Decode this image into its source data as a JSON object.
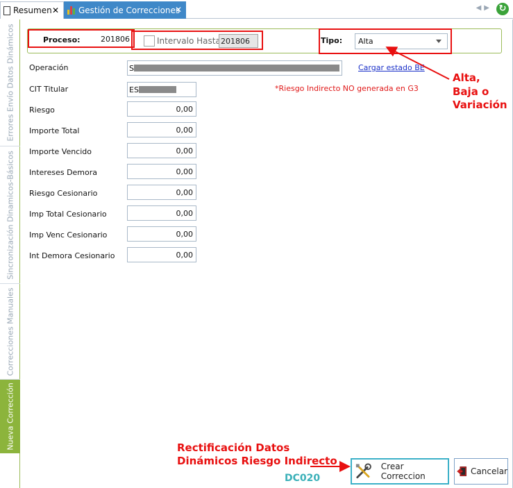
{
  "tabs": [
    {
      "label": "Resumen",
      "active": false
    },
    {
      "label": "Gestión de Correcciones",
      "active": true
    }
  ],
  "side_tabs": [
    {
      "label": "Errores Envío Datos Dinámicos"
    },
    {
      "label": "Sincronización Dinamicos-Básicos"
    },
    {
      "label": "Correcciones Manuales"
    },
    {
      "label": "Nueva Corrección",
      "active": true
    }
  ],
  "header": {
    "proceso_label": "Proceso:",
    "proceso_value": "201806",
    "intervalo_label": "Intervalo Hasta",
    "intervalo_checked": false,
    "intervalo_value": "201806",
    "tipo_label": "Tipo:",
    "tipo_value": "Alta"
  },
  "form": {
    "operacion_label": "Operación",
    "operacion_value": "S",
    "cargar_link": "Cargar estado BE",
    "cit_label": "CIT Titular",
    "cit_value": "ES",
    "warning": "*Riesgo Indirecto NO generada en G3",
    "fields": [
      {
        "label": "Riesgo",
        "value": "0,00"
      },
      {
        "label": "Importe Total",
        "value": "0,00"
      },
      {
        "label": "Importe Vencido",
        "value": "0,00"
      },
      {
        "label": "Intereses Demora",
        "value": "0,00"
      },
      {
        "label": "Riesgo Cesionario",
        "value": "0,00"
      },
      {
        "label": "Imp Total Cesionario",
        "value": "0,00"
      },
      {
        "label": "Imp Venc Cesionario",
        "value": "0,00"
      },
      {
        "label": "Int Demora Cesionario",
        "value": "0,00"
      }
    ]
  },
  "annotations": {
    "tipo_note_1": "Alta,",
    "tipo_note_2": "Baja o",
    "tipo_note_3": "Variación",
    "button_note_1": "Rectificación Datos",
    "button_note_2": "Dinámicos Riesgo Indirecto",
    "code": "DC020"
  },
  "buttons": {
    "crear": "Crear Correccion",
    "cancelar": "Cancelar"
  },
  "colors": {
    "active_tab": "#3f88c8",
    "side_active": "#8cb43c",
    "highlight_red": "#e81010",
    "link_blue": "#1a30c8",
    "code_teal": "#3ab0b8"
  }
}
